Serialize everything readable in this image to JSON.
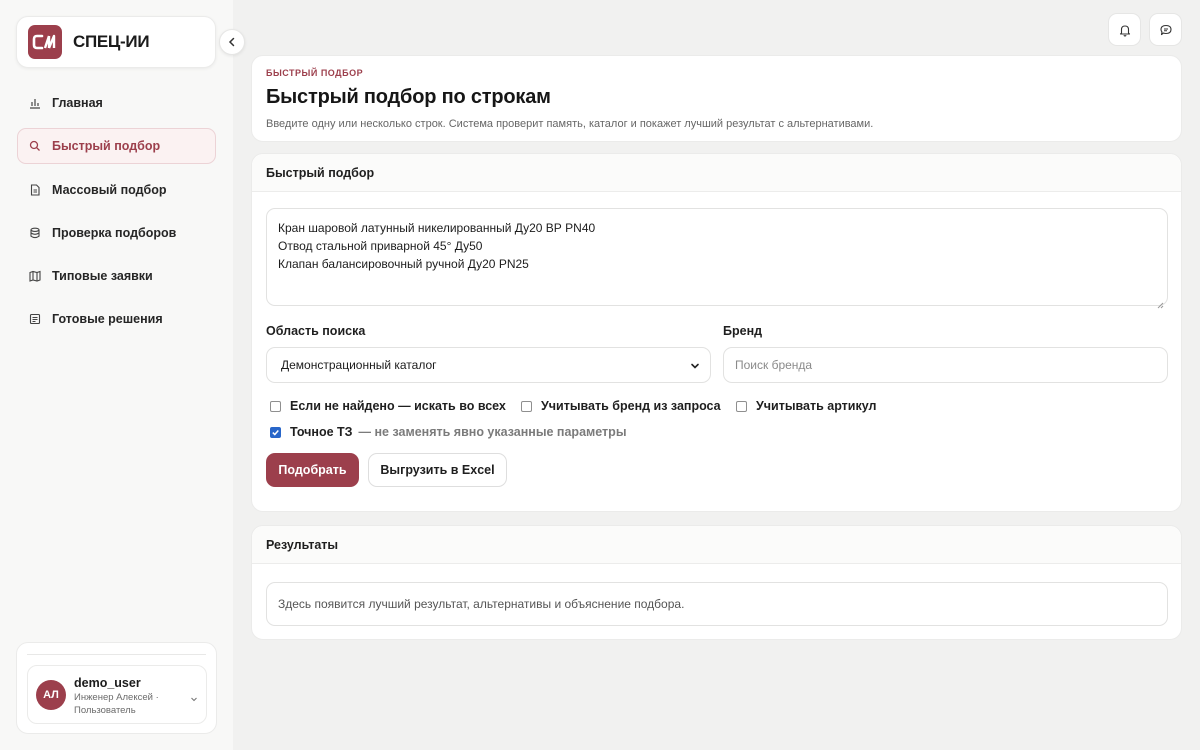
{
  "brand": {
    "name": "СПЕЦ-ИИ",
    "logo_text": "СИ"
  },
  "nav": {
    "items": [
      {
        "label": "Главная",
        "icon": "bar-chart-icon"
      },
      {
        "label": "Быстрый подбор",
        "icon": "search-icon"
      },
      {
        "label": "Массовый подбор",
        "icon": "file-icon"
      },
      {
        "label": "Проверка подборов",
        "icon": "database-icon"
      },
      {
        "label": "Типовые заявки",
        "icon": "map-icon"
      },
      {
        "label": "Готовые решения",
        "icon": "list-icon"
      }
    ],
    "active_index": 1
  },
  "user": {
    "name": "demo_user",
    "initials": "АЛ",
    "role": "Инженер Алексей · Пользователь"
  },
  "header": {
    "eyebrow": "БЫСТРЫЙ ПОДБОР",
    "title": "Быстрый подбор по строкам",
    "subtitle": "Введите одну или несколько строк. Система проверит память, каталог и покажет лучший результат с альтернативами."
  },
  "form": {
    "card_title": "Быстрый подбор",
    "query_value": "Кран шаровой латунный никелированный Ду20 ВР PN40\nОтвод стальной приварной 45° Ду50\nКлапан балансировочный ручной Ду20 PN25",
    "scope_label": "Область поиска",
    "scope_value": "Демонстрационный каталог",
    "brand_label": "Бренд",
    "brand_placeholder": "Поиск бренда",
    "checks": {
      "search_all": {
        "label": "Если не найдено — искать во всех",
        "checked": false
      },
      "brand_from_query": {
        "label": "Учитывать бренд из запроса",
        "checked": false
      },
      "article": {
        "label": "Учитывать артикул",
        "checked": false
      },
      "exact_spec": {
        "label": "Точное ТЗ",
        "hint": "— не заменять явно указанные параметры",
        "checked": true
      }
    },
    "submit_label": "Подобрать",
    "export_label": "Выгрузить в Excel"
  },
  "results": {
    "card_title": "Результаты",
    "empty_text": "Здесь появится лучший результат, альтернативы и объяснение подбора."
  },
  "colors": {
    "accent": "#9c3f4c",
    "checkbox": "#2866c9"
  }
}
